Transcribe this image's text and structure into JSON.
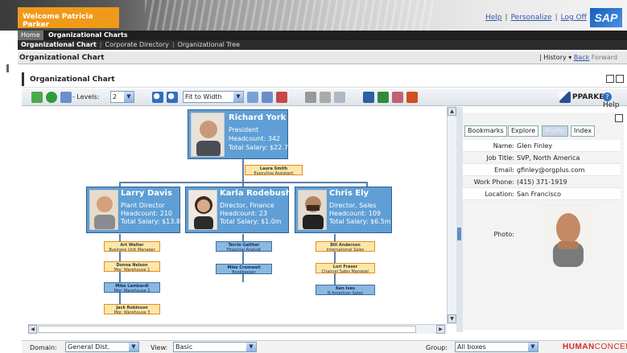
{
  "header": {
    "welcome": "Welcome Patricia Parker",
    "links": [
      "Help",
      "Personalize",
      "Log Off"
    ],
    "logo": "SAP"
  },
  "tabs": {
    "home": "Home",
    "active": "Organizational Charts"
  },
  "subnav": {
    "active": "Organizational Chart",
    "items": [
      "Corporate Directory",
      "Organizational Tree"
    ]
  },
  "page": {
    "title": "Organizational Chart",
    "history": "History",
    "back": "Back",
    "forward": "Forward"
  },
  "panel": {
    "title": "Organizational Chart"
  },
  "toolbar": {
    "levels_label": "- Levels:",
    "levels_value": "2",
    "zoom_value": "Fit to Width",
    "user": "PPARKER",
    "help": "Help"
  },
  "chart": {
    "top": {
      "name": "Richard York",
      "lines": [
        "President",
        "Headcount:  342",
        "Total Salary: $22.7m"
      ]
    },
    "assistant": {
      "name": "Laura Smith",
      "role": "Executive Assistant"
    },
    "managers": [
      {
        "name": "Larry  Davis",
        "lines": [
          "Plant Director",
          "Headcount:   210",
          "Total Salary: $13.8m"
        ]
      },
      {
        "name": "Karla Rodebush",
        "lines": [
          "Director, Finance",
          "Headcount:    23",
          "Total Salary: $1.0m"
        ]
      },
      {
        "name": "Chris Ely",
        "lines": [
          "Director, Sales",
          "Headcount:   109",
          "Total Salary: $6.5m"
        ]
      }
    ],
    "reports": [
      [
        {
          "name": "Art Walter",
          "role": "Business Unit Manager"
        },
        {
          "name": "Donna Nelson",
          "role": "Mgr. Warehouse 1"
        },
        {
          "name": "Mike Lambardi",
          "role": "Mgr. Warehouse 2"
        },
        {
          "name": "Jack Robinson",
          "role": "Mgr. Warehouse 3"
        }
      ],
      [
        {
          "name": "Terrie Gaither",
          "role": "Financial Analyst"
        },
        {
          "name": "Mike Cromwell",
          "role": "Bookkeeper"
        }
      ],
      [
        {
          "name": "Bill Anderson",
          "role": "International Sales"
        },
        {
          "name": "Lori Fraser",
          "role": "Channel Sales Manager"
        },
        {
          "name": "Ken Ives",
          "role": "N American Sales"
        }
      ]
    ]
  },
  "profile": {
    "tabs": [
      "Bookmarks",
      "Explore",
      "Profile",
      "Index"
    ],
    "rows": [
      {
        "k": "Name:",
        "v": "Glen Finley"
      },
      {
        "k": "Job Title:",
        "v": "SVP, North America"
      },
      {
        "k": "Email:",
        "v": "gfinley@orgplus.com"
      },
      {
        "k": "Work Phone:",
        "v": "(415) 371-1919"
      },
      {
        "k": "Location:",
        "v": "San Francisco"
      }
    ],
    "photo_label": "Photo:"
  },
  "footer": {
    "domain_label": "Domain:",
    "domain_value": "General Dist.",
    "view_label": "View:",
    "view_value": "Basic",
    "group_label": "Group:",
    "group_value": "All boxes",
    "brand_bold": "HUMAN",
    "brand_light": "CONCEPTS"
  },
  "colors": {
    "node": "#5f9fd5",
    "accent": "#f09a1a"
  }
}
